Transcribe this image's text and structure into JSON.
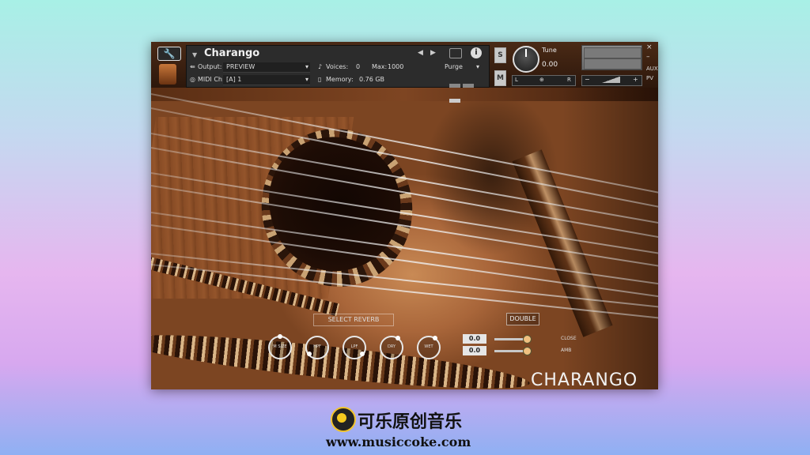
{
  "header": {
    "instrument_name": "Charango",
    "output_label": "Output:",
    "output_value": "PREVIEW",
    "midi_label": "MIDI Ch:",
    "midi_value": "[A] 1",
    "voices_label": "Voices:",
    "voices_value": "0",
    "max_label": "Max:",
    "max_value": "1000",
    "memory_label": "Memory:",
    "memory_value": "0.76 GB",
    "purge_label": "Purge",
    "info_icon": "i",
    "s_button": "S",
    "m_button": "M",
    "tune_label": "Tune",
    "tune_value": "0.00",
    "pan_left": "L",
    "pan_right": "R",
    "vol_minus": "−",
    "vol_plus": "+",
    "aux_label": "AUX",
    "pv_label": "PV",
    "close_glyph": "×",
    "minimize_glyph": "–"
  },
  "controls": {
    "select_reverb": "SELECT REVERB",
    "double": "DOUBLE",
    "knobs": [
      {
        "label": "M SIZE"
      },
      {
        "label": "HPF"
      },
      {
        "label": "LPF"
      },
      {
        "label": "DRY"
      },
      {
        "label": "WET"
      }
    ],
    "close_value": "0.0",
    "close_label": "CLOSE",
    "amb_value": "0.0",
    "amb_label": "AMB",
    "brand_text": "CHARANGO"
  },
  "watermark": {
    "name": "可乐原创音乐",
    "url": "www.musiccoke.com"
  }
}
